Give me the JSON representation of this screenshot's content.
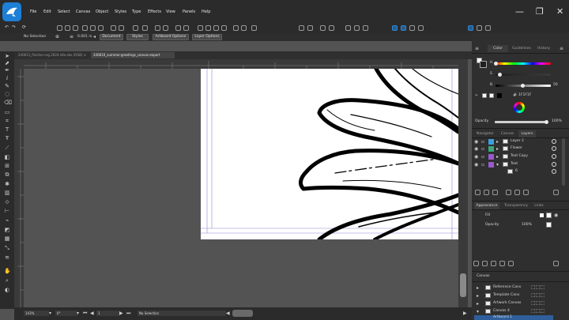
{
  "menu": {
    "items": [
      "File",
      "Edit",
      "Select",
      "Canvas",
      "Object",
      "Styles",
      "Type",
      "Effects",
      "View",
      "Panels",
      "Help"
    ]
  },
  "window_controls": {
    "minimize": "—",
    "maximize": "❐",
    "close": "✕"
  },
  "context_bar": {
    "selection": "No Selection",
    "stroke_value": "0.001 in",
    "document_btn": "Document",
    "styles_btn": "Styles",
    "artboard_options_btn": "Artboard Options",
    "layer_options_btn": "Layer Options"
  },
  "doc_tabs": [
    {
      "label": "240611_finisher-rag 2024-idle.ebs (RGB) ✕",
      "active": false
    },
    {
      "label": "240610_summer-greetings_canvas-export",
      "active": true
    }
  ],
  "status": {
    "zoom": "143%",
    "angle": "0°",
    "page": "1",
    "selection": "No Selection"
  },
  "color_panel": {
    "tabs": [
      "Color",
      "Guidelines",
      "History"
    ],
    "channels": [
      {
        "label": "H",
        "value": "",
        "pos": 0.0
      },
      {
        "label": "S",
        "value": "",
        "pos": 0.08
      },
      {
        "label": "B",
        "value": "50",
        "pos": 0.5
      }
    ],
    "hex": "1F1F1F",
    "opacity_label": "Opacity",
    "opacity_value": "100%"
  },
  "layers_panel": {
    "tabs": [
      "Navigator",
      "Canvas",
      "Layers"
    ],
    "layers": [
      {
        "name": "Layer 2",
        "color": "#3aa0e0",
        "expanded": false,
        "indent": 0
      },
      {
        "name": "Flower",
        "color": "#3aa77a",
        "expanded": false,
        "indent": 0
      },
      {
        "name": "Text Copy",
        "color": "#9b59d0",
        "expanded": false,
        "indent": 0
      },
      {
        "name": "Text",
        "color": "#9b59d0",
        "expanded": true,
        "indent": 0
      },
      {
        "name": "6",
        "color": "",
        "expanded": false,
        "indent": 1
      }
    ]
  },
  "appearance_panel": {
    "tabs": [
      "Appearance",
      "Transparency",
      "Links"
    ],
    "fill_label": "Fill",
    "opacity_label": "Opacity",
    "opacity_value": "100%"
  },
  "canvas_panel": {
    "title": "Canvas",
    "items": [
      "Reference Canv",
      "Template Canv",
      "Artwork Canvas",
      "Canvas 4",
      "Artboard 1"
    ]
  },
  "colors": {
    "accent": "#1d7fd6",
    "dark_bg": "#2b2b2b",
    "workspace": "#535353"
  }
}
